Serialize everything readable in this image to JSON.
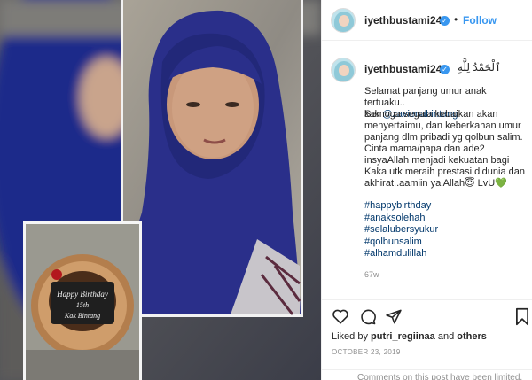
{
  "post": {
    "username": "iyethbustami24",
    "follow_label": "Follow",
    "separator": "•",
    "caption_title": "ٱلْحَمْدُ لِلَّٰهِ",
    "caption_line1": "Selamat panjang umur anak tertuaku..\nkak ",
    "mention": "@zavienabintang",
    "caption_body": "Semoga segala kebaikan akan menyertaimu, dan keberkahan umur panjang dlm pribadi yg qolbun salim. Cinta mama/papa dan ade2 insyaAllah menjadi kekuatan bagi Kaka utk meraih prestasi didunia dan akhirat..aamiin ya Allah😇 LvU💚",
    "hashtags": [
      "#happybirthday",
      "#anaksolehah",
      "#selalubersyukur",
      "#qolbunsalim",
      "#alhamdulillah"
    ],
    "age": "67w",
    "liked_by_prefix": "Liked by ",
    "liked_by_user": "putri_regiinaa",
    "liked_by_mid": " and ",
    "liked_by_others": "others",
    "date": "OCTOBER 23, 2019",
    "comments_limited": "Comments on this post have been limited."
  },
  "photo": {
    "cake_text_line1": "Happy Birthday",
    "cake_text_line2": "15th",
    "cake_text_line3": "Kak Bintang"
  },
  "icons": [
    "heart-icon",
    "comment-icon",
    "share-icon",
    "bookmark-icon",
    "verified-icon"
  ],
  "colors": {
    "accent": "#3897f0",
    "link": "#00376b",
    "hijab": "#2a2f8a",
    "muted": "#8e8e8e"
  }
}
